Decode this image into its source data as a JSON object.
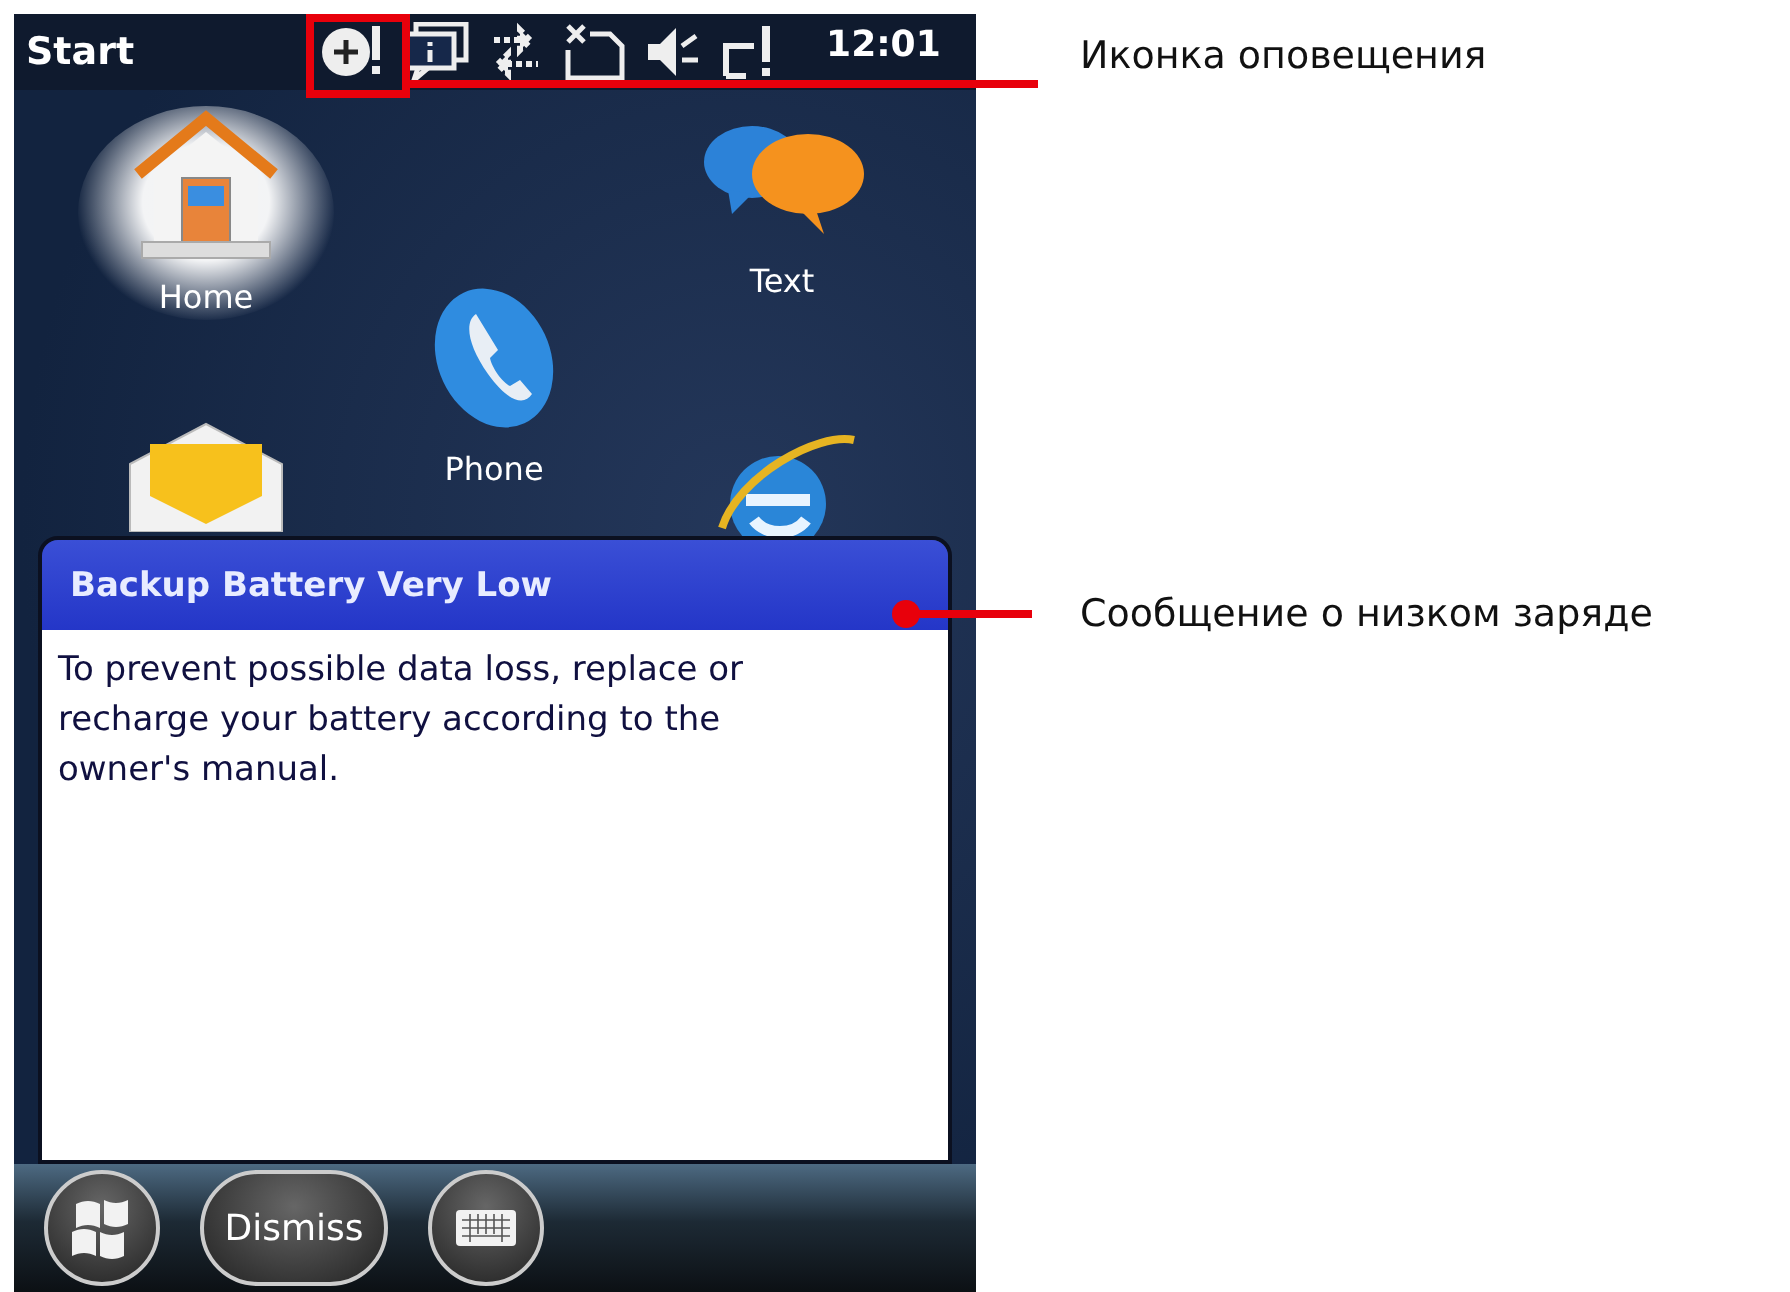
{
  "status_bar": {
    "title": "Start",
    "time": "12:01"
  },
  "tiles": [
    {
      "kind": "home",
      "label": "Home",
      "selected": true
    },
    {
      "kind": "phone",
      "label": "Phone",
      "selected": false
    },
    {
      "kind": "text",
      "label": "Text",
      "selected": false
    },
    {
      "kind": "mail",
      "selected": false
    },
    {
      "kind": "browser",
      "selected": false
    }
  ],
  "dialog": {
    "title": "Backup Battery Very Low",
    "message": "To prevent possible data loss, replace or recharge your battery according to the owner's manual."
  },
  "softkeys": [
    {
      "kind": "start"
    },
    {
      "kind": "button",
      "label": "Dismiss"
    },
    {
      "kind": "keyboard"
    }
  ],
  "annotations": [
    {
      "kind": "frame",
      "text": "Иконка оповещения"
    },
    {
      "kind": "dot",
      "text": "Сообщение о низком заряде"
    }
  ]
}
